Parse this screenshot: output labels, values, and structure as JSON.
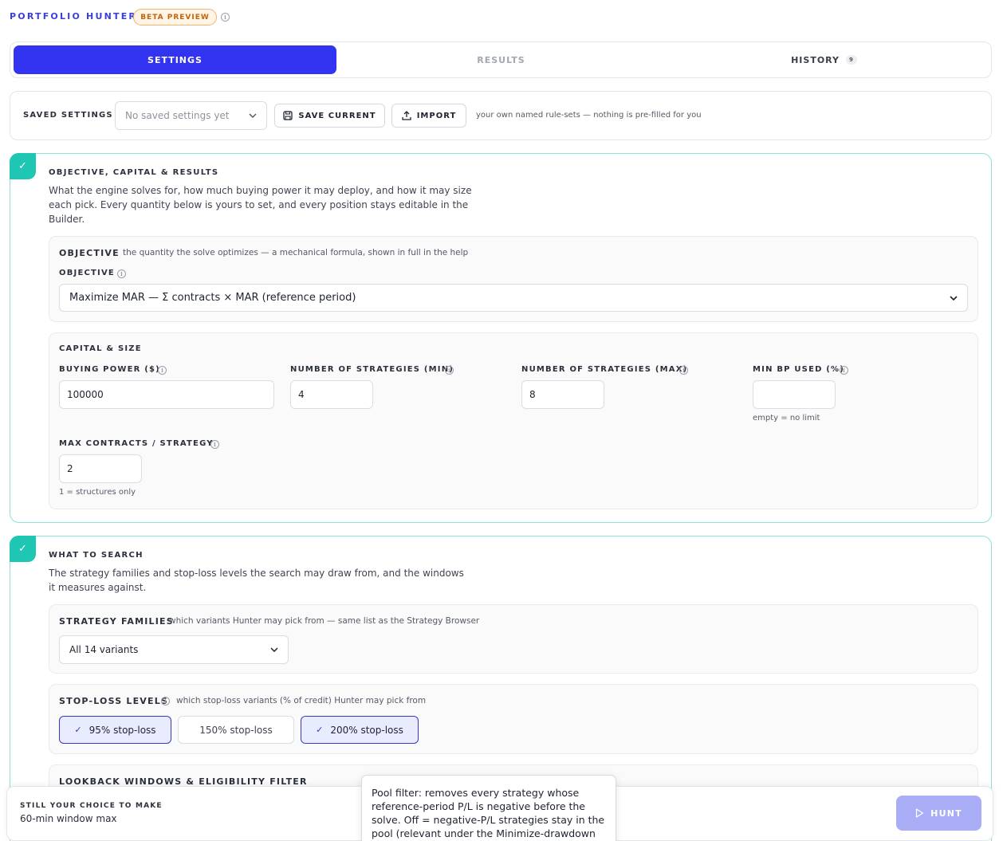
{
  "header": {
    "brand": "PORTFOLIO HUNTER",
    "beta": "BETA PREVIEW",
    "info_icon": "info-icon"
  },
  "tabs": [
    {
      "label": "SETTINGS",
      "active": true
    },
    {
      "label": "RESULTS",
      "active": false
    },
    {
      "label": "HISTORY",
      "active": false,
      "badge": "9"
    }
  ],
  "saved_settings": {
    "label": "SAVED SETTINGS",
    "select_value": "No saved settings yet",
    "save_button": "SAVE CURRENT",
    "import_button": "IMPORT",
    "hint": "your own named rule-sets — nothing is pre-filled for you"
  },
  "section1": {
    "check": "✓",
    "title": "OBJECTIVE, CAPITAL & RESULTS",
    "desc_lines": [
      "What the engine solves for, how much buying power it may deploy, and how it may size",
      "each pick. Every quantity below is yours to set, and every position stays editable in the",
      "Builder."
    ],
    "objective": {
      "heading": "OBJECTIVE",
      "heading_hint": "the quantity the solve optimizes — a mechanical formula, shown in full in the help",
      "field_label": "OBJECTIVE",
      "value": "Maximize MAR — Σ contracts × MAR (reference period)"
    },
    "capital": {
      "heading": "CAPITAL & SIZE",
      "buying_power_label": "BUYING POWER ($)",
      "buying_power_value": "100000",
      "min_strategies_label": "NUMBER OF STRATEGIES (MIN)",
      "min_strategies_value": "4",
      "max_strategies_label": "NUMBER OF STRATEGIES (MAX)",
      "max_strategies_value": "8",
      "min_bp_label": "MIN BP USED (%)",
      "min_bp_value": "",
      "min_bp_hint": "empty = no limit",
      "max_contracts_label": "MAX CONTRACTS / STRATEGY",
      "max_contracts_value": "2",
      "max_contracts_hint": "1 = structures only"
    }
  },
  "section2": {
    "check": "✓",
    "title": "WHAT TO SEARCH",
    "desc_lines": [
      "The strategy families and stop-loss levels the search may draw from, and the windows",
      "it measures against."
    ],
    "families": {
      "heading": "STRATEGY FAMILIES",
      "heading_hint": "which variants Hunter may pick from — same list as the Strategy Browser",
      "value": "All 14 variants"
    },
    "stoploss": {
      "heading": "STOP-LOSS LEVELS",
      "heading_hint": "which stop-loss variants (% of credit) Hunter may pick from",
      "chips": [
        {
          "label": "95% stop-loss",
          "selected": true
        },
        {
          "label": "150% stop-loss",
          "selected": false
        },
        {
          "label": "200% stop-loss",
          "selected": true
        }
      ]
    },
    "lookback": {
      "heading": "LOOKBACK WINDOWS & ELIGIBILITY FILTER"
    }
  },
  "footer": {
    "label": "STILL YOUR CHOICE TO MAKE",
    "value": "60-min window max",
    "hunt_button": "HUNT"
  },
  "tooltip": {
    "text": "Pool filter: removes every strategy whose reference-period P/L is negative before the solve. Off = negative-P/L strategies stay in the pool (relevant under the Minimize-drawdown"
  },
  "colors": {
    "accent": "#3333f2",
    "teal": "#1fc6b3",
    "beta_bg": "#fff4e6",
    "beta_text": "#c2630a"
  }
}
